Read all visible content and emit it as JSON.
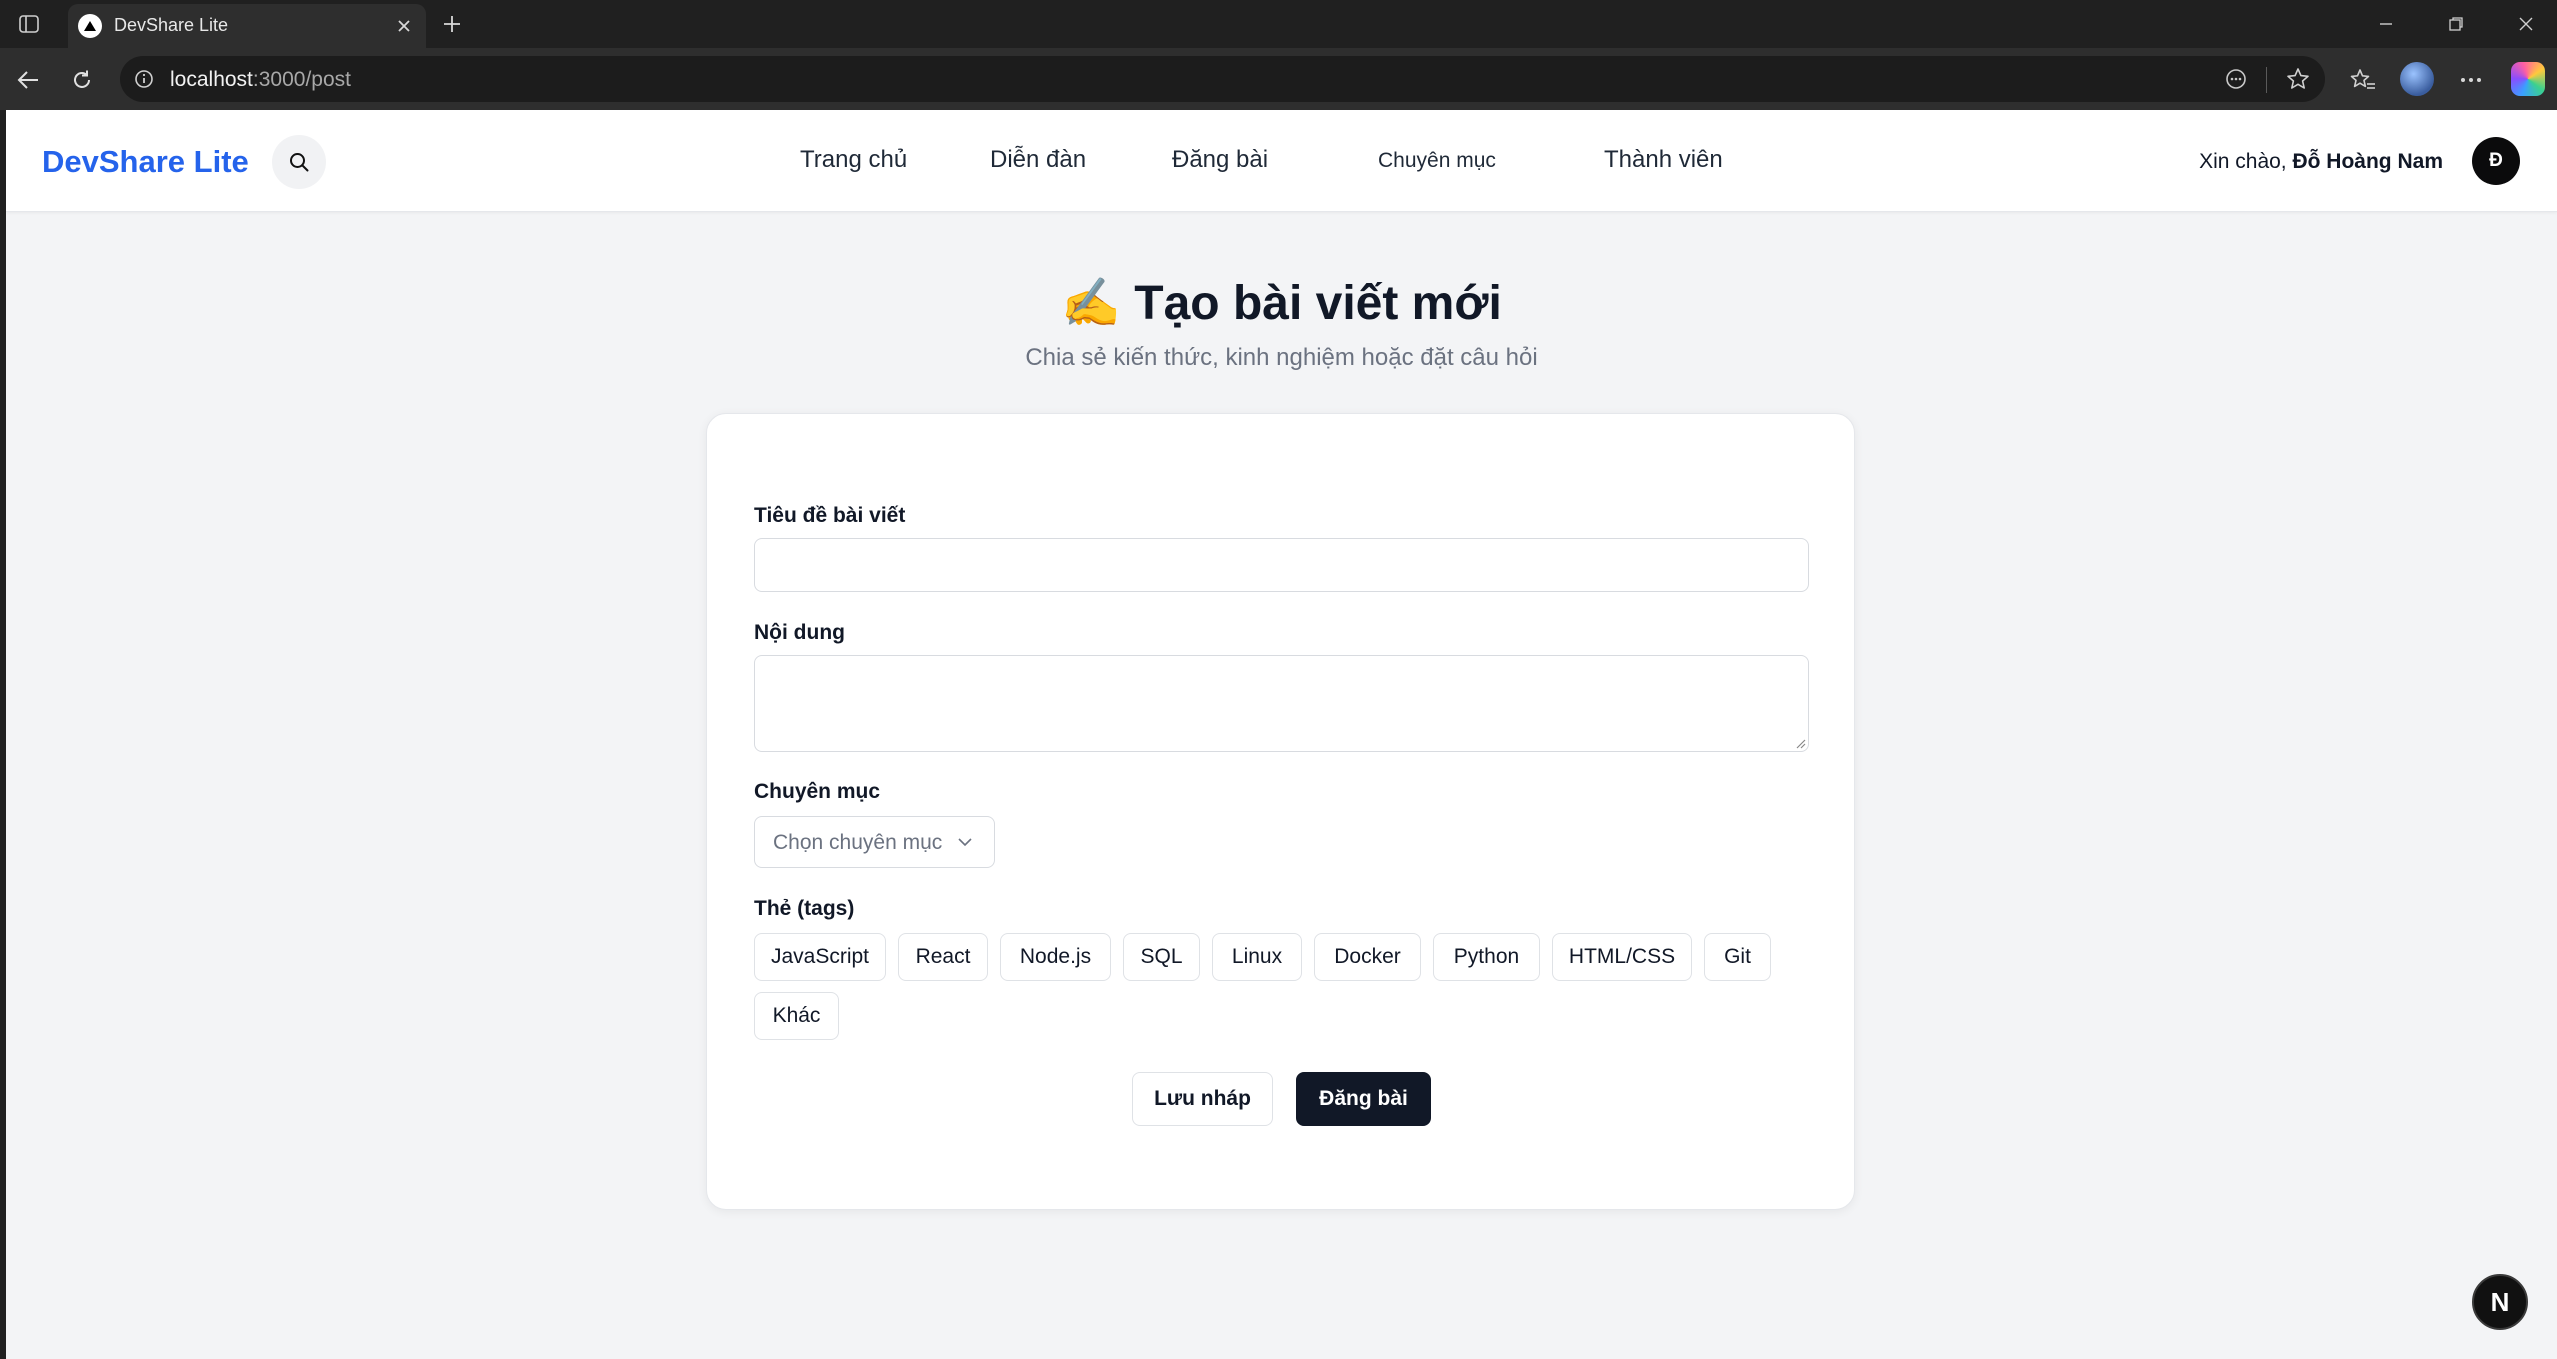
{
  "browser": {
    "tab_title": "DevShare Lite",
    "url_host": "localhost",
    "url_path": ":3000/post"
  },
  "header": {
    "brand": "DevShare Lite",
    "nav": [
      "Trang chủ",
      "Diễn đàn",
      "Đăng bài",
      "Chuyên mục",
      "Thành viên"
    ],
    "greeting_prefix": "Xin chào, ",
    "user_name": "Đỗ Hoàng Nam",
    "avatar_initial": "Đ"
  },
  "page": {
    "title": "✍️ Tạo bài viết mới",
    "subtitle": "Chia sẻ kiến thức, kinh nghiệm hoặc đặt câu hỏi"
  },
  "form": {
    "title_label": "Tiêu đề bài viết",
    "title_value": "",
    "content_label": "Nội dung",
    "content_value": "",
    "category_label": "Chuyên mục",
    "category_placeholder": "Chọn chuyên mục",
    "tags_label": "Thẻ (tags)",
    "tags": [
      "JavaScript",
      "React",
      "Node.js",
      "SQL",
      "Linux",
      "Docker",
      "Python",
      "HTML/CSS",
      "Git",
      "Khác"
    ],
    "draft_button": "Lưu nháp",
    "submit_button": "Đăng bài"
  },
  "dev_badge": "N",
  "icons": {
    "search": "search-icon",
    "back": "back-arrow-icon",
    "refresh": "refresh-icon",
    "info": "info-icon",
    "star": "star-icon",
    "favorites": "favorites-icon",
    "menu": "more-icon",
    "chevron": "chevron-down-icon"
  },
  "colors": {
    "brand": "#2563eb",
    "primary_button": "#111827",
    "page_bg": "#f3f4f6"
  }
}
